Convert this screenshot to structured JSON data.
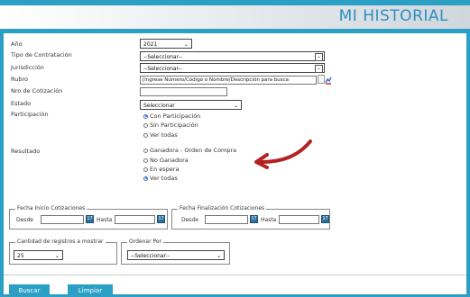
{
  "header": {
    "title": "MI HISTORIAL"
  },
  "form": {
    "anio": {
      "label": "Año",
      "value": "2021"
    },
    "tipo_contratacion": {
      "label": "Tipo de Contratación",
      "value": "--Seleccionar--"
    },
    "jurisdiccion": {
      "label": "Jurisdicción",
      "value": "--Seleccionar--"
    },
    "rubro": {
      "label": "Rubro",
      "placeholder": "[Ingrese Número/Código o Nombre/Descripción para busca"
    },
    "nro_cotizacion": {
      "label": "Nro de Cotización",
      "value": ""
    },
    "estado": {
      "label": "Estado",
      "value": "Seleccionar"
    },
    "participacion": {
      "label": "Participación",
      "options": [
        "Con Participación",
        "Sin Participación",
        "Ver todas"
      ],
      "selected": "Con Participación"
    },
    "resultado": {
      "label": "Resultado",
      "options": [
        "Ganadora - Orden de Compra",
        "No Ganadora",
        "En espera",
        "Ver todas"
      ],
      "selected": "Ver todas"
    },
    "fecha_inicio": {
      "legend": "Fecha Inicio Cotizaciones",
      "desde": "Desde",
      "hasta": "Hasta",
      "cal": "17"
    },
    "fecha_fin": {
      "legend": "Fecha Finalización Cotizaciones",
      "desde": "Desde",
      "hasta": "Hasta",
      "cal": "17"
    },
    "cantidad": {
      "legend": "Cantidad de registros a mostrar",
      "value": "25"
    },
    "ordenar": {
      "legend": "Ordenar Por",
      "value": "--Seleccionar--"
    }
  },
  "buttons": {
    "buscar": "Buscar",
    "limpiar": "Limpiar"
  },
  "colors": {
    "accent": "#2c9fc4",
    "arrow": "#b22222",
    "title": "#2c8fc2"
  },
  "annotation": {
    "icon": "red-curved-arrow-icon"
  }
}
